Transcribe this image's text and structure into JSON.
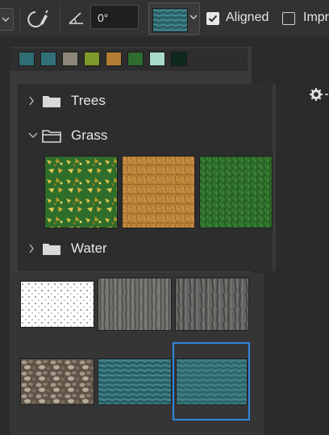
{
  "options_bar": {
    "angle_value": "0°",
    "aligned_label": "Aligned",
    "aligned_checked": true,
    "impression_label": "Impr",
    "impression_checked": false,
    "current_pattern": "water-pattern"
  },
  "recent_patterns": [
    {
      "name": "water-blue-1",
      "color": "#2f6e74"
    },
    {
      "name": "water-blue-2",
      "color": "#336f78"
    },
    {
      "name": "gravel",
      "color": "#8d8779"
    },
    {
      "name": "yellow-leaves",
      "color": "#7f9a2a"
    },
    {
      "name": "dry-grass",
      "color": "#b37e33"
    },
    {
      "name": "green-grass",
      "color": "#2e6c2f"
    },
    {
      "name": "mint",
      "color": "#a8dcc8"
    },
    {
      "name": "dark-green-sparkle",
      "color": "#0f2a1c"
    }
  ],
  "folders": [
    {
      "name": "Trees",
      "expanded": false
    },
    {
      "name": "Grass",
      "expanded": true
    },
    {
      "name": "Water",
      "expanded": false
    }
  ],
  "grass_patterns": [
    {
      "name": "yellow-leaves-pattern"
    },
    {
      "name": "dry-grass-pattern"
    },
    {
      "name": "green-grass-pattern"
    }
  ],
  "loose_patterns": [
    {
      "name": "dots-pattern"
    },
    {
      "name": "bark-pattern-1"
    },
    {
      "name": "bark-pattern-2"
    },
    {
      "name": "gravel-pattern"
    },
    {
      "name": "water-pattern-1"
    },
    {
      "name": "water-pattern-2",
      "selected": true
    }
  ],
  "colors": {
    "selection": "#2f86e0",
    "panel": "#3a3a3a",
    "bar": "#323232"
  }
}
